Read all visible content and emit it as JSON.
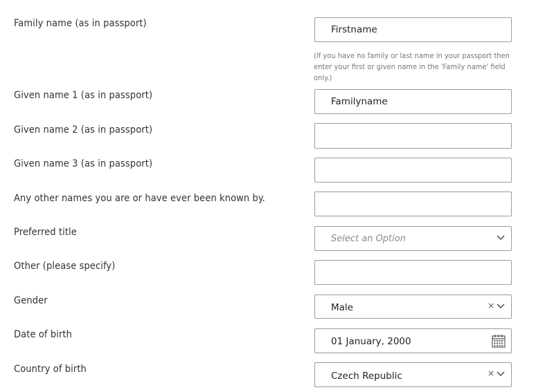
{
  "form": {
    "family_name": {
      "label": "Family name (as in passport)",
      "value": "Firstname",
      "hint": "(If you have no family or last name in your passport then enter your first or given name in the 'Family name' field only.)"
    },
    "given_name_1": {
      "label": "Given name 1 (as in passport)",
      "value": "Familyname"
    },
    "given_name_2": {
      "label": "Given name 2 (as in passport)",
      "value": ""
    },
    "given_name_3": {
      "label": "Given name 3 (as in passport)",
      "value": ""
    },
    "other_names": {
      "label": "Any other names you are or have ever been known by.",
      "value": ""
    },
    "preferred_title": {
      "label": "Preferred title",
      "placeholder": "Select an Option"
    },
    "other_specify": {
      "label": "Other (please specify)",
      "value": ""
    },
    "gender": {
      "label": "Gender",
      "value": "Male",
      "clear": "×"
    },
    "date_of_birth": {
      "label": "Date of birth",
      "value": "01 January, 2000"
    },
    "country_of_birth": {
      "label": "Country of birth",
      "value": "Czech Republic",
      "clear": "×"
    }
  },
  "icons": {
    "dropdown": "chevron-down-icon",
    "clear": "close-icon",
    "calendar": "calendar-icon"
  }
}
